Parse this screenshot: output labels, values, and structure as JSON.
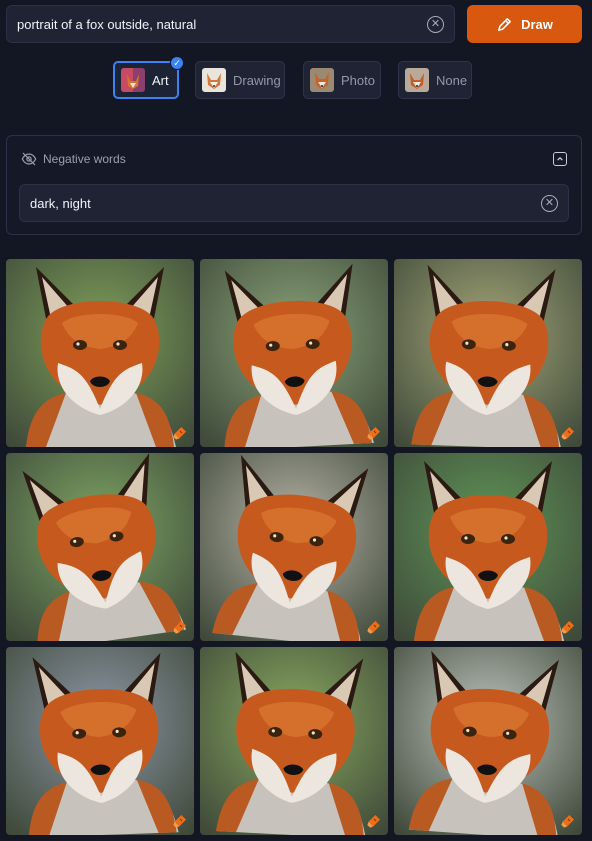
{
  "prompt": {
    "value": "portrait of a fox outside, natural",
    "clear_icon": "circle-x-icon"
  },
  "draw_button": {
    "label": "Draw",
    "icon": "pencil-icon",
    "color": "#d8580f"
  },
  "styles": {
    "selected": "Art",
    "options": [
      {
        "label": "Art",
        "icon": "art-thumbnail"
      },
      {
        "label": "Drawing",
        "icon": "drawing-thumbnail"
      },
      {
        "label": "Photo",
        "icon": "photo-thumbnail"
      },
      {
        "label": "None",
        "icon": "none-thumbnail"
      }
    ]
  },
  "negative": {
    "title": "Negative words",
    "icon": "eye-off-icon",
    "collapse_icon": "chevron-up-icon",
    "value": "dark, night"
  },
  "results": {
    "tile_icon": "paintbrush-icon",
    "images": [
      {
        "subject": "red fox portrait",
        "bg": "#7fa05a"
      },
      {
        "subject": "red fox portrait",
        "bg": "#8aa278"
      },
      {
        "subject": "red fox portrait",
        "bg": "#a5a678"
      },
      {
        "subject": "red fox portrait",
        "bg": "#7ea664"
      },
      {
        "subject": "red fox portrait",
        "bg": "#b7b3a7"
      },
      {
        "subject": "red fox portrait",
        "bg": "#5f9657"
      },
      {
        "subject": "red fox portrait",
        "bg": "#8e97a7"
      },
      {
        "subject": "red fox portrait",
        "bg": "#8aa95f"
      },
      {
        "subject": "red fox portrait",
        "bg": "#bfc4be"
      }
    ]
  },
  "colors": {
    "background": "#131623",
    "accent": "#3b82f6",
    "fox_orange": "#c65a1e"
  }
}
